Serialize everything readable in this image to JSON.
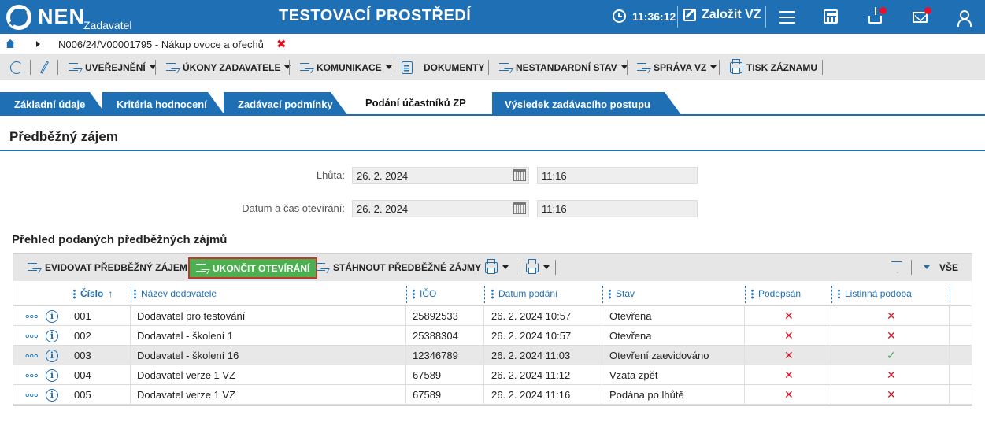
{
  "header": {
    "logo_text": "NEN",
    "logo_sub": "Zadavatel",
    "env_title": "TESTOVACÍ PROSTŘEDÍ",
    "time": "11:36:12",
    "create_label": "Založit VZ"
  },
  "breadcrumb": {
    "text": "N006/24/V00001795 - Nákup ovoce a ořechů",
    "close": "✖"
  },
  "toolbar": {
    "publish": "UVEŘEJNĚNÍ",
    "actions": "ÚKONY ZADAVATELE",
    "communication": "KOMUNIKACE",
    "documents": "DOKUMENTY",
    "nonstandard": "NESTANDARDNÍ STAV",
    "management": "SPRÁVA VZ",
    "print": "TISK ZÁZNAMU"
  },
  "tabs": [
    {
      "label": "Základní údaje"
    },
    {
      "label": "Kritéria hodnocení"
    },
    {
      "label": "Zadávací podmínky"
    },
    {
      "label": "Podání účastníků ZP"
    },
    {
      "label": "Výsledek zadávacího postupu"
    }
  ],
  "section": {
    "title": "Předběžný zájem",
    "deadline_label": "Lhůta:",
    "deadline_date": "26. 2. 2024",
    "deadline_time": "11:16",
    "opening_label": "Datum a čas otevírání:",
    "opening_date": "26. 2. 2024",
    "opening_time": "11:16"
  },
  "list": {
    "title": "Přehled podaných předběžných zájmů",
    "btn_register": "EVIDOVAT PŘEDBĚŽNÝ ZÁJEM",
    "btn_finish": "UKONČIT OTEVÍRÁNÍ",
    "btn_download": "STÁHNOUT PŘEDBĚŽNÉ ZÁJMY",
    "filter_all": "VŠE",
    "columns": {
      "number": "Číslo",
      "sort_arrow": "↑",
      "supplier": "Název dodavatele",
      "ico": "IČO",
      "submitted": "Datum podání",
      "status": "Stav",
      "signed": "Podepsán",
      "paper": "Listinná podoba"
    },
    "rows": [
      {
        "number": "001",
        "supplier": "Dodavatel pro testování",
        "ico": "25892533",
        "submitted": "26. 2. 2024 10:57",
        "status": "Otevřena",
        "signed": "✕",
        "paper": "✕"
      },
      {
        "number": "002",
        "supplier": "Dodavatel - školení 1",
        "ico": "25388304",
        "submitted": "26. 2. 2024 10:57",
        "status": "Otevřena",
        "signed": "✕",
        "paper": "✕"
      },
      {
        "number": "003",
        "supplier": "Dodavatel - školení 16",
        "ico": "12346789",
        "submitted": "26. 2. 2024 11:03",
        "status": "Otevření zaevidováno",
        "signed": "✕",
        "paper": "✓"
      },
      {
        "number": "004",
        "supplier": "Dodavatel verze 1 VZ",
        "ico": "67589",
        "submitted": "26. 2. 2024 11:12",
        "status": "Vzata zpět",
        "signed": "✕",
        "paper": "✕"
      },
      {
        "number": "005",
        "supplier": "Dodavatel verze 1 VZ",
        "ico": "67589",
        "submitted": "26. 2. 2024 11:16",
        "status": "Podána po lhůtě",
        "signed": "✕",
        "paper": "✕"
      }
    ]
  },
  "icons": {
    "info_glyph": "i"
  },
  "colors": {
    "brand": "#1f6fb4",
    "accent_green": "#4caf50",
    "error_red": "#d81324",
    "ok_green": "#3aa24a"
  }
}
